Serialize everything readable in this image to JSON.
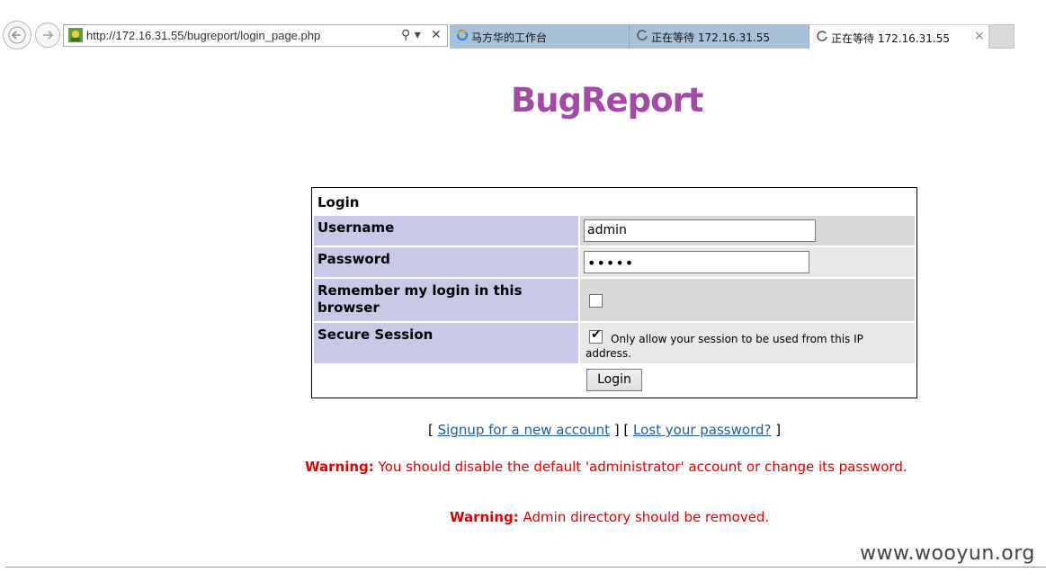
{
  "browser": {
    "url": "http://172.16.31.55/bugreport/login_page.php",
    "search_glyph": "⚲ ▾",
    "close_glyph": "✕",
    "tabs": [
      {
        "label": "马方华的工作台",
        "icon": "ie-icon"
      },
      {
        "label": "正在等待 172.16.31.55",
        "icon": "loading-icon"
      },
      {
        "label": "正在等待 172.16.31.55",
        "icon": "loading-icon",
        "close": "×"
      }
    ]
  },
  "page": {
    "logo": "BugReport",
    "login": {
      "title": "Login",
      "username_label": "Username",
      "username_value": "admin",
      "password_label": "Password",
      "password_value": "•••••",
      "remember_label": "Remember my login in this browser",
      "remember_checked": false,
      "secure_label": "Secure Session",
      "secure_checked": true,
      "secure_check_glyph": "✔",
      "secure_note": "Only allow your session to be used from this IP address.",
      "button": "Login"
    },
    "links": {
      "open1": "[ ",
      "signup": "Signup for a new account",
      "mid": " ]  [ ",
      "lost": "Lost your password?",
      "close2": " ]"
    },
    "warnings": [
      {
        "prefix": "Warning:",
        "text": " You should disable the default 'administrator' account or change its password."
      },
      {
        "prefix": "Warning:",
        "text": " Admin directory should be removed."
      }
    ],
    "watermark": "www.wooyun.org"
  },
  "colors": {
    "logo": "#a24aa6",
    "label_bg": "#c8c8e8",
    "warning": "#e00000",
    "link": "#1a5fa3"
  }
}
